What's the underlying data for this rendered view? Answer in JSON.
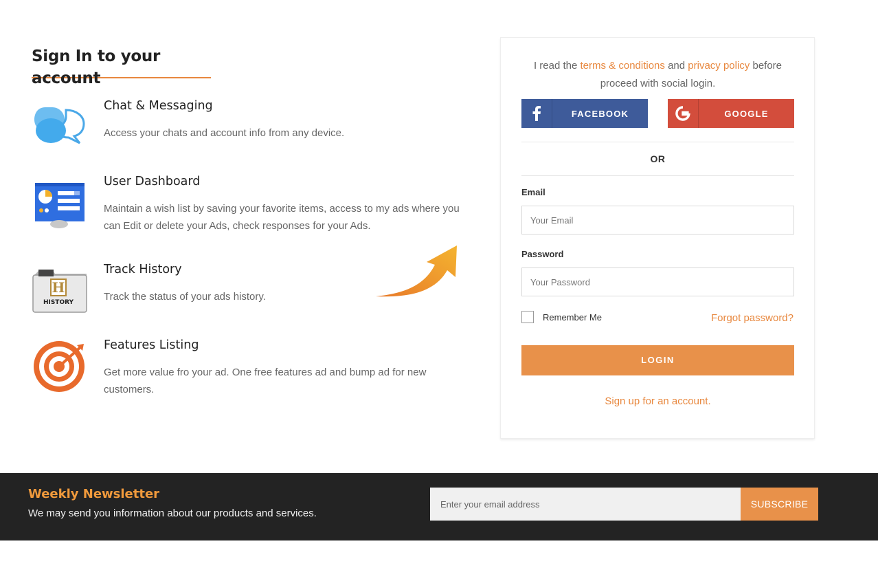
{
  "signin": {
    "title": "Sign In to your account",
    "features": [
      {
        "title": "Chat & Messaging",
        "desc": "Access your chats and account info from any device.",
        "icon": "chat-bubbles-icon"
      },
      {
        "title": "User Dashboard",
        "desc": "Maintain a wish list by saving your favorite items, access to my ads where you can Edit or delete your Ads, check responses for your Ads.",
        "icon": "dashboard-icon"
      },
      {
        "title": "Track History",
        "desc": "Track the status of your ads history.",
        "icon": "history-folder-icon"
      },
      {
        "title": "Features Listing",
        "desc": "Get more value fro your ad. One free features ad and bump ad for new customers.",
        "icon": "target-icon"
      }
    ]
  },
  "card": {
    "terms_prefix": "I read the ",
    "terms_link": "terms & conditions",
    "terms_and": " and ",
    "privacy_link": "privacy policy",
    "terms_suffix": " before proceed with social login.",
    "facebook_label": "FACEBOOK",
    "google_label": "GOOGLE",
    "or_label": "OR",
    "email_label": "Email",
    "email_placeholder": "Your Email",
    "password_label": "Password",
    "password_placeholder": "Your Password",
    "remember_label": "Remember Me",
    "forgot_label": "Forgot password?",
    "login_label": "LOGIN",
    "signup_label": "Sign up for an account."
  },
  "newsletter": {
    "title": "Weekly Newsletter",
    "subtitle": "We may send you information about our products and services.",
    "email_placeholder": "Enter your email address",
    "subscribe_label": "SUBSCRIBE"
  },
  "colors": {
    "accent": "#e8883f",
    "facebook": "#3e5b9a",
    "google": "#d34d3c",
    "footer_bg": "#232323"
  }
}
